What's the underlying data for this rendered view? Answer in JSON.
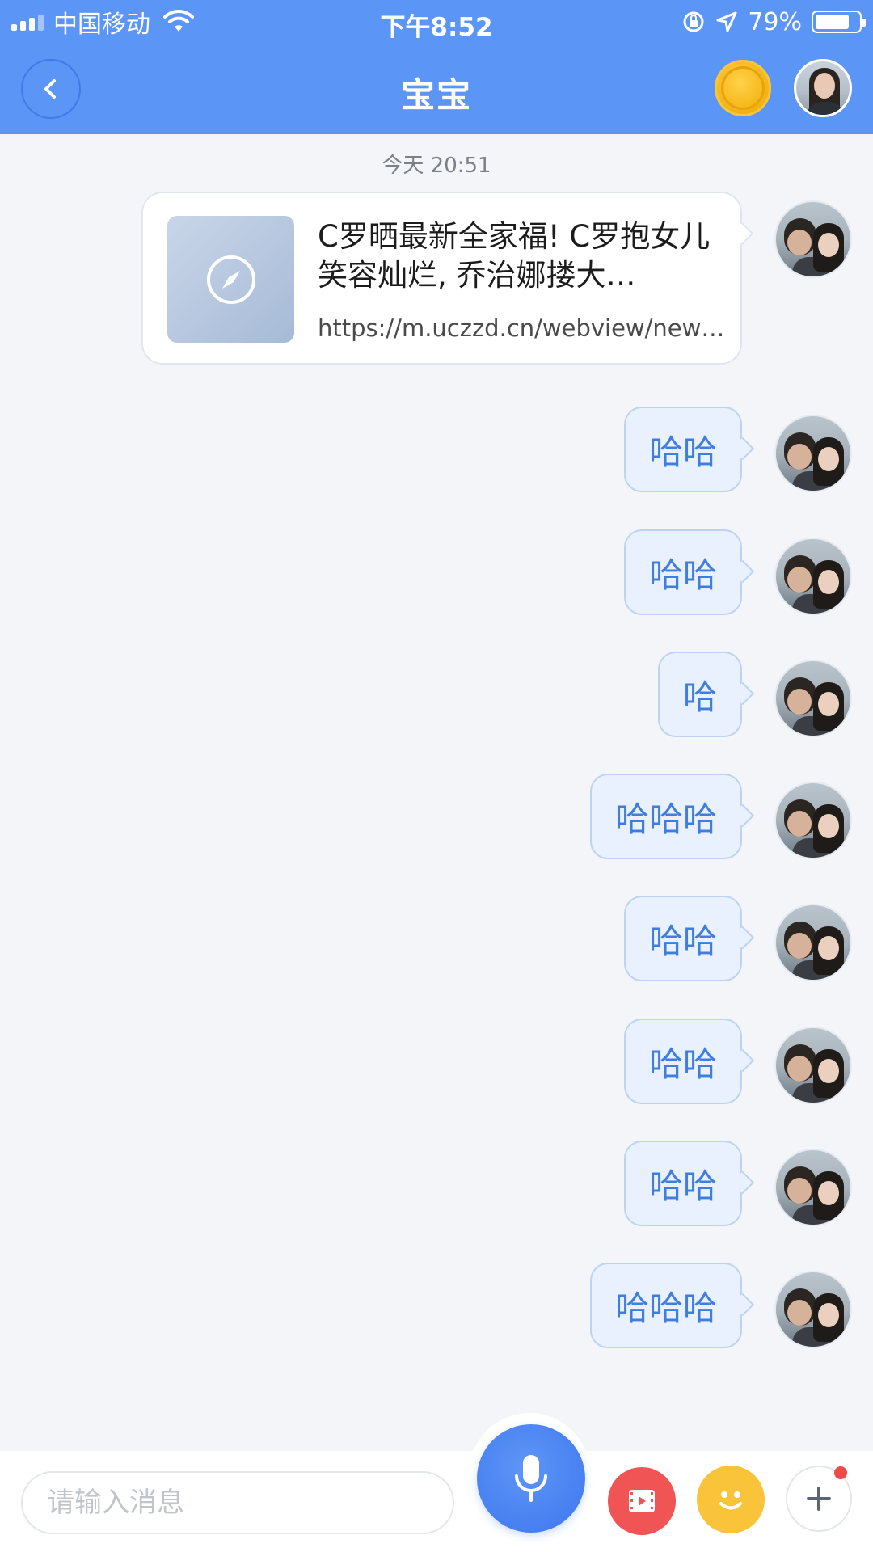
{
  "status_bar": {
    "carrier": "中国移动",
    "time": "下午8:52",
    "battery_percent": "79%",
    "battery_level": 0.79
  },
  "nav": {
    "title": "宝宝",
    "back_icon": "chevron-left-icon",
    "coin_icon": "coin-icon"
  },
  "chat": {
    "timestamp": "今天 20:51",
    "link_card": {
      "title": "C罗晒最新全家福! C罗抱女儿笑容灿烂, 乔治娜搂大…",
      "url": "https://m.uczzd.cn/webview/new…",
      "thumb_icon": "compass-icon"
    },
    "messages": [
      {
        "text": "哈哈"
      },
      {
        "text": "哈哈"
      },
      {
        "text": "哈"
      },
      {
        "text": "哈哈哈"
      },
      {
        "text": "哈哈"
      },
      {
        "text": "哈哈"
      },
      {
        "text": "哈哈"
      },
      {
        "text": "哈哈哈"
      }
    ]
  },
  "input_bar": {
    "placeholder": "请输入消息",
    "buttons": [
      "mic-icon",
      "video-icon",
      "emoji-icon",
      "plus-icon"
    ]
  },
  "colors": {
    "header": "#5b95f6",
    "bubble_bg": "#e8f1fd",
    "bubble_text": "#3f7de0",
    "mic": "#3d76ee",
    "video": "#f15454",
    "emoji": "#f9c43a"
  }
}
